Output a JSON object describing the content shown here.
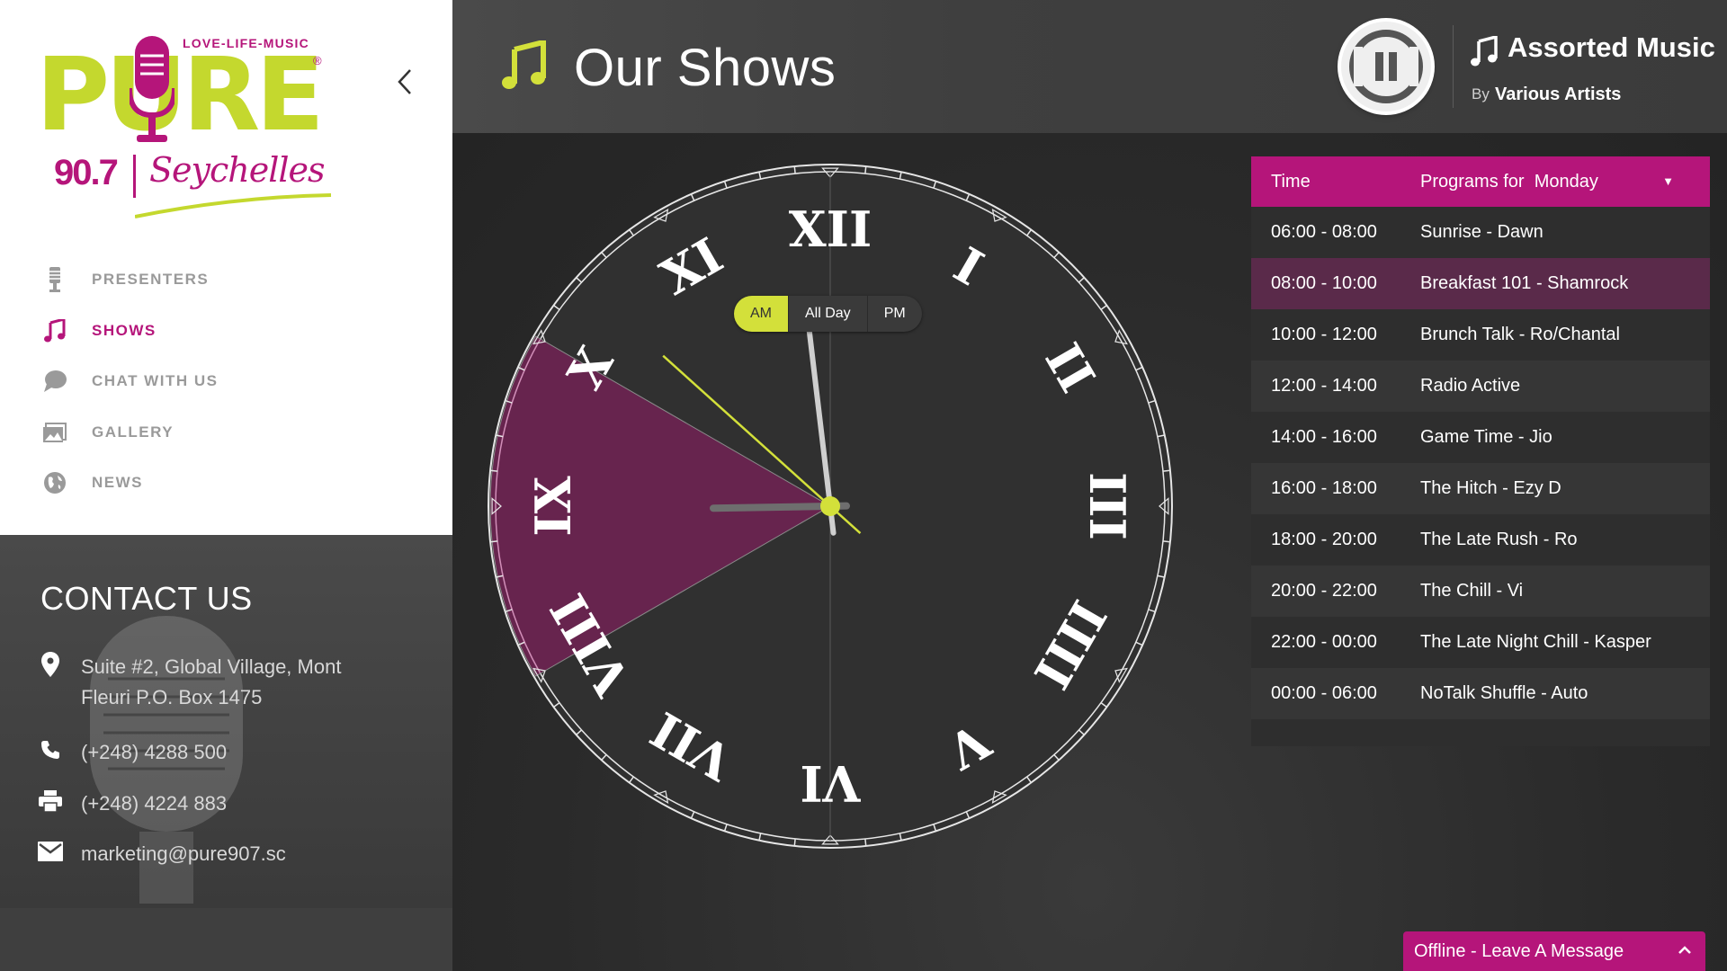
{
  "logo": {
    "tagline": "LOVE-LIFE-MUSIC",
    "brand": "PURE",
    "registered": "®",
    "frequency": "90.7",
    "city": "Seychelles"
  },
  "nav": {
    "items": [
      {
        "label": "PRESENTERS",
        "icon": "microphone-icon",
        "active": false
      },
      {
        "label": "SHOWS",
        "icon": "music-note-icon",
        "active": true
      },
      {
        "label": "CHAT WITH US",
        "icon": "chat-bubble-icon",
        "active": false
      },
      {
        "label": "GALLERY",
        "icon": "image-icon",
        "active": false
      },
      {
        "label": "NEWS",
        "icon": "globe-icon",
        "active": false
      }
    ]
  },
  "contact": {
    "title": "CONTACT US",
    "address_line1": "Suite #2, Global Village, Mont",
    "address_line2": "Fleuri P.O. Box 1475",
    "phone": "(+248) 4288 500",
    "fax": "(+248) 4224 883",
    "email": "marketing@pure907.sc"
  },
  "header": {
    "title": "Our Shows",
    "now_playing": {
      "title": "Assorted Music",
      "by_label": "By",
      "artist": "Various Artists",
      "state": "playing"
    }
  },
  "clock": {
    "toggle": [
      {
        "label": "AM",
        "active": true
      },
      {
        "label": "All Day",
        "active": false
      },
      {
        "label": "PM",
        "active": false
      }
    ],
    "numerals": [
      "XII",
      "I",
      "II",
      "III",
      "IIII",
      "V",
      "VI",
      "VII",
      "VIII",
      "IX",
      "X",
      "XI"
    ],
    "highlight_from_hour": 8,
    "highlight_to_hour": 10,
    "time": {
      "hour": 8,
      "minute": 58,
      "second": 52
    },
    "colors": {
      "accent": "#d3e03a",
      "highlight": "#b5157a"
    }
  },
  "schedule": {
    "header_time": "Time",
    "header_programs": "Programs for",
    "day": "Monday",
    "rows": [
      {
        "time": "06:00 - 08:00",
        "program": "Sunrise - Dawn",
        "active": false
      },
      {
        "time": "08:00 - 10:00",
        "program": "Breakfast 101 - Shamrock",
        "active": true
      },
      {
        "time": "10:00 - 12:00",
        "program": "Brunch Talk - Ro/Chantal",
        "active": false
      },
      {
        "time": "12:00 - 14:00",
        "program": "Radio Active",
        "active": false
      },
      {
        "time": "14:00 - 16:00",
        "program": "Game Time - Jio",
        "active": false
      },
      {
        "time": "16:00 - 18:00",
        "program": "The Hitch - Ezy D",
        "active": false
      },
      {
        "time": "18:00 - 20:00",
        "program": "The Late Rush - Ro",
        "active": false
      },
      {
        "time": "20:00 - 22:00",
        "program": "The Chill - Vi",
        "active": false
      },
      {
        "time": "22:00 - 00:00",
        "program": "The Late Night Chill - Kasper",
        "active": false
      },
      {
        "time": "00:00 - 06:00",
        "program": "NoTalk Shuffle - Auto",
        "active": false
      }
    ]
  },
  "chat_widget": {
    "label": "Offline - Leave A Message"
  },
  "colors": {
    "brand_magenta": "#b5157a",
    "brand_lime": "#c4d82e",
    "accent_lime": "#d3e03a"
  }
}
